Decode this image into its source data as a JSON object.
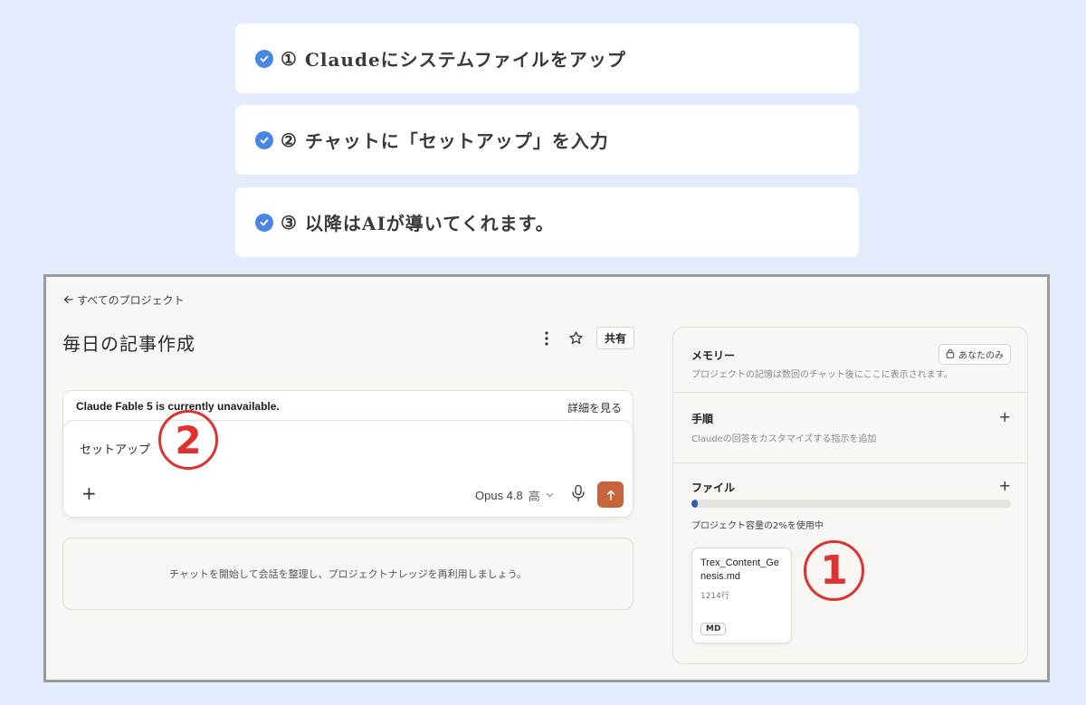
{
  "steps": [
    {
      "number": "①",
      "text": "Claudeにシステムファイルをアップ"
    },
    {
      "number": "②",
      "text": "チャットに「セットアップ」を入力"
    },
    {
      "number": "③",
      "text": "以降はAIが導いてくれます。"
    }
  ],
  "nav": {
    "back_label": "すべてのプロジェクト"
  },
  "project": {
    "title": "毎日の記事作成",
    "share_label": "共有"
  },
  "notice": {
    "message": "Claude Fable 5 is currently unavailable.",
    "link_label": "詳細を見る"
  },
  "composer": {
    "input_text": "セットアップ",
    "model": "Opus 4.8",
    "effort": "高"
  },
  "empty_state": {
    "text": "チャットを開始して会話を整理し、プロジェクトナレッジを再利用しましょう。"
  },
  "side_panel": {
    "memory": {
      "heading": "メモリー",
      "description": "プロジェクトの記憶は数回のチャット後にここに表示されます。",
      "badge": "あなたのみ"
    },
    "instructions": {
      "heading": "手順",
      "description": "Claudeの回答をカスタマイズする指示を追加"
    },
    "files": {
      "heading": "ファイル",
      "usage_fraction": 0.02,
      "usage_text": "プロジェクト容量の2%を使用中",
      "items": [
        {
          "name": "Trex_Content_Genesis.md",
          "lines": "1214行",
          "type": "MD"
        }
      ]
    }
  },
  "annotations": {
    "one": "1",
    "two": "2"
  },
  "colors": {
    "background": "#e3edfb",
    "check": "#4a86e8",
    "send_button": "#c8643b",
    "annotation": "#e03131",
    "progress": "#2d5fb8"
  }
}
